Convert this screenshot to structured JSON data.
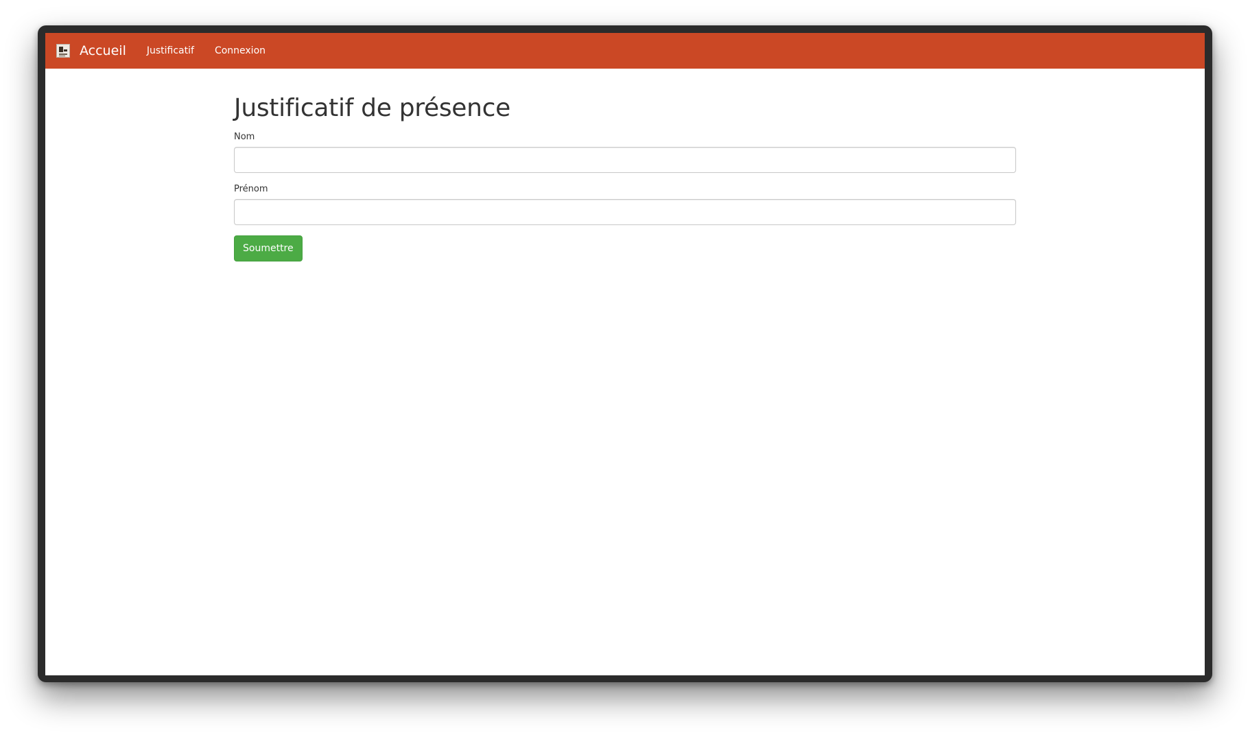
{
  "navbar": {
    "brand_label": "Accueil",
    "brand_logo_icon": "site-logo-icon",
    "links": [
      {
        "label": "Justificatif"
      },
      {
        "label": "Connexion"
      }
    ],
    "background_color": "#cb4825"
  },
  "main": {
    "title": "Justificatif de présence",
    "fields": {
      "nom": {
        "label": "Nom",
        "value": "",
        "placeholder": ""
      },
      "prenom": {
        "label": "Prénom",
        "value": "",
        "placeholder": ""
      }
    },
    "submit_label": "Soumettre",
    "submit_color": "#4cab45"
  }
}
